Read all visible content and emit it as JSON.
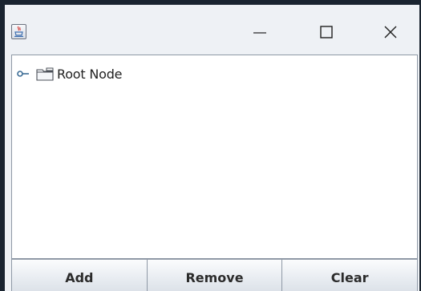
{
  "window": {
    "icon": "java-cup-icon",
    "controls": {
      "minimize": "minimize-icon",
      "maximize": "maximize-icon",
      "close": "close-icon"
    }
  },
  "tree": {
    "nodes": [
      {
        "label": "Root Node",
        "handle_icon": "tree-handle-icon",
        "icon": "folder-icon"
      }
    ]
  },
  "buttons": {
    "add": "Add",
    "remove": "Remove",
    "clear": "Clear"
  },
  "colors": {
    "window_frame": "#1a2430",
    "window_background": "#eef1f5",
    "panel_background": "#ffffff",
    "border": "#8f99a6"
  }
}
